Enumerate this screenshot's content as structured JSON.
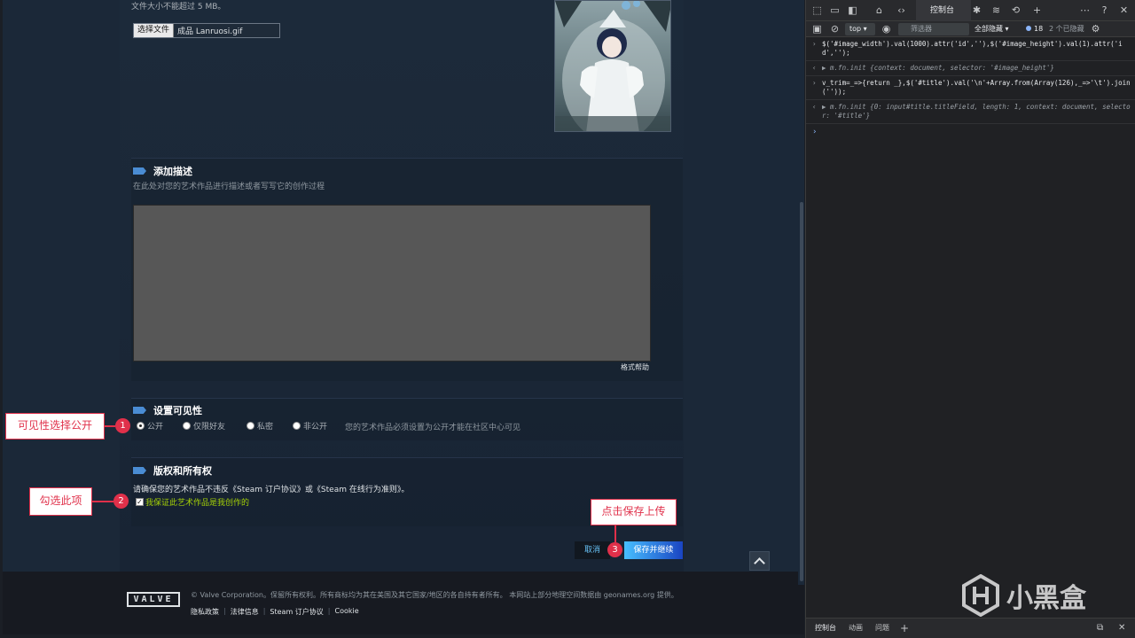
{
  "steam": {
    "upload_hint": "文件大小不能超过 5 MB。",
    "file_button": "选择文件",
    "file_name": "成品 Lanruosi.gif",
    "description": {
      "title": "添加描述",
      "subtitle": "在此处对您的艺术作品进行描述或者写写它的创作过程",
      "textarea_value": "",
      "format_help": "格式帮助"
    },
    "visibility": {
      "title": "设置可见性",
      "options": [
        "公开",
        "仅限好友",
        "私密",
        "非公开"
      ],
      "selected": "公开",
      "note": "您的艺术作品必须设置为公开才能在社区中心可见"
    },
    "copyright": {
      "title": "版权和所有权",
      "note": "请确保您的艺术作品不违反《Steam 订户协议》或《Steam 在线行为准则》。",
      "checkbox_label": "我保证此艺术作品是我创作的",
      "checked": true
    },
    "buttons": {
      "cancel": "取消",
      "save": "保存并继续"
    },
    "footer": {
      "logo": "VALVE",
      "legal": "© Valve Corporation。保留所有权利。所有商标均为其在美国及其它国家/地区的各自持有者所有。 本网站上部分地理空间数据由 geonames.org 提供。",
      "links": [
        "隐私政策",
        "法律信息",
        "Steam 订户协议",
        "Cookie"
      ]
    }
  },
  "annotations": {
    "a1": {
      "num": "1",
      "text": "可见性选择公开"
    },
    "a2": {
      "num": "2",
      "text": "勾选此项"
    },
    "a3": {
      "num": "3",
      "text": "点击保存上传"
    }
  },
  "devtools": {
    "active_tab": "控制台",
    "context": "top",
    "filter_placeholder": "筛选器",
    "levels": "全部隐藏",
    "issue_count": "18",
    "hidden_count": "2 个已隐藏",
    "console": [
      {
        "type": "in",
        "text": "$('#image_width').val(1000).attr('id',''),$('#image_height').val(1).attr('id','');"
      },
      {
        "type": "out",
        "text": "▶ m.fn.init {context: document, selector: '#image_height'}"
      },
      {
        "type": "in",
        "text": "v_trim=_=>{return _},$('#title').val('\\n'+Array.from(Array(126),_=>'\\t').join(''));"
      },
      {
        "type": "out",
        "text": "▶ m.fn.init {0: input#title.titleField, length: 1, context: document, selector: '#title'}"
      }
    ],
    "bottom_tabs": [
      "控制台",
      "动画",
      "问题"
    ]
  },
  "watermark": {
    "text": "小黑盒"
  },
  "colors": {
    "steam_bg": "#1b2838",
    "annotation_red": "#e0304a",
    "check_green": "#a4d007",
    "save_gradient_start": "#47bfff",
    "save_gradient_end": "#1a44c2"
  }
}
